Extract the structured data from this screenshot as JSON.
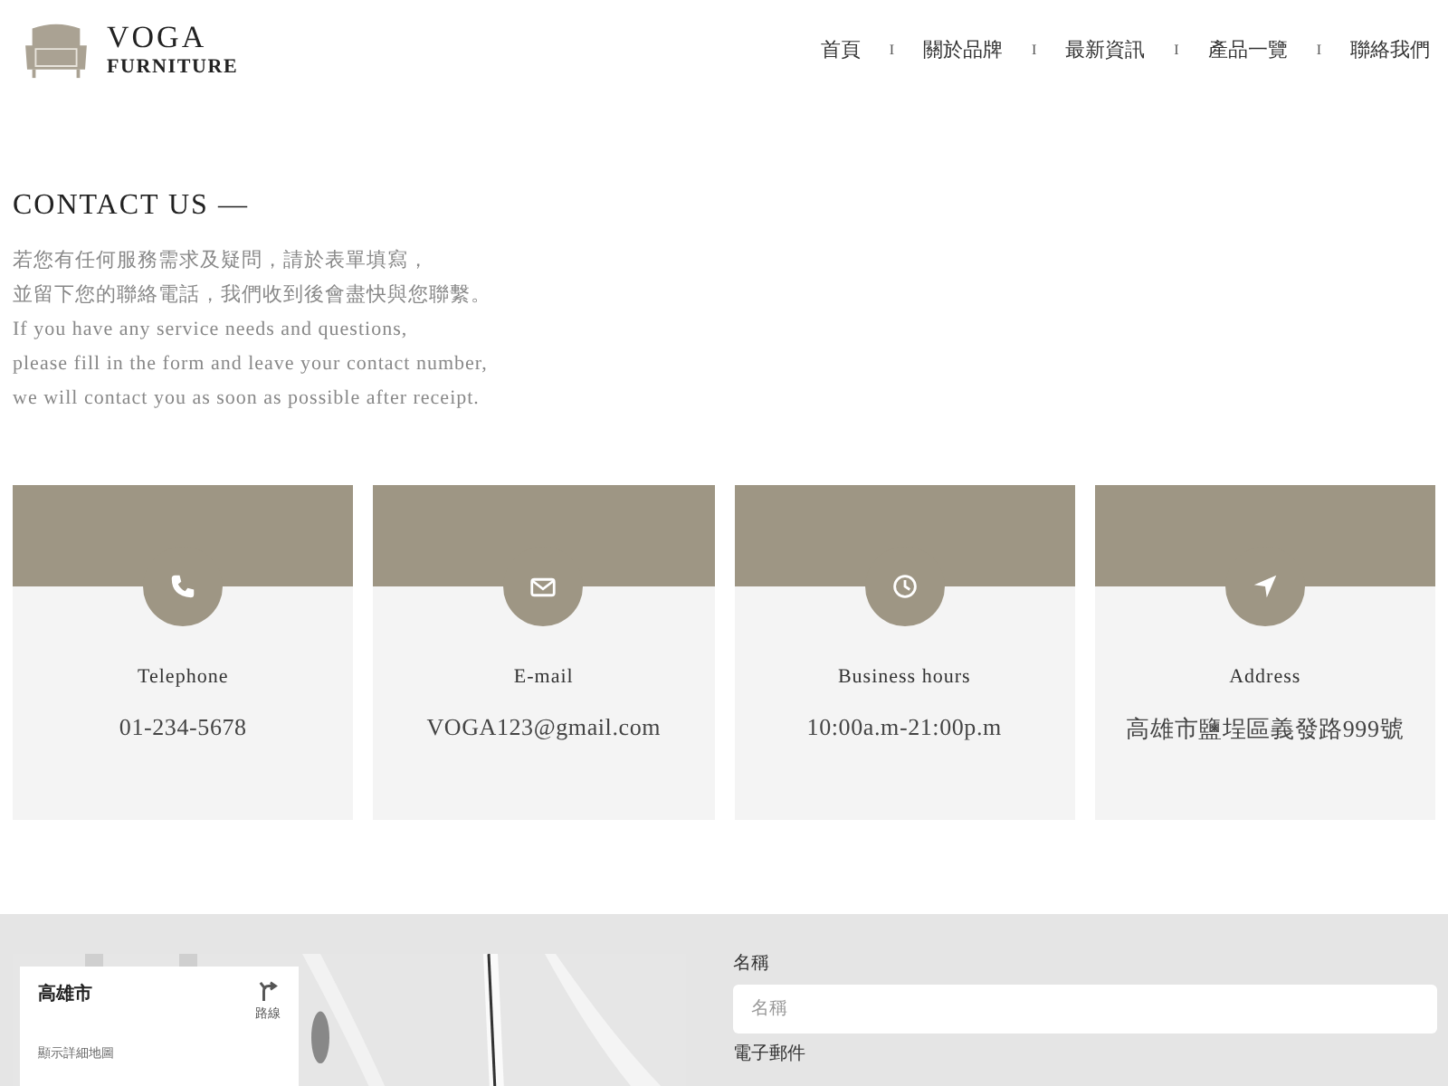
{
  "logo": {
    "name": "VOGA",
    "subtitle": "FURNITURE"
  },
  "nav": [
    {
      "label": "首頁",
      "selected": false
    },
    {
      "label": "關於品牌",
      "selected": false
    },
    {
      "label": "最新資訊",
      "selected": false
    },
    {
      "label": "產品一覽",
      "selected": false
    },
    {
      "label": "聯絡我們",
      "selected": false
    }
  ],
  "nav_separators": [
    "I",
    "I",
    "I",
    "I"
  ],
  "contact": {
    "title": "CONTACT US —",
    "paragraph": [
      "若您有任何服務需求及疑問，請於表單填寫，",
      "並留下您的聯絡電話，我們收到後會盡快與您聯繫。",
      "If you have any service needs and questions,",
      "please fill in the form and leave your contact number,",
      "we will contact you as soon as possible after receipt."
    ]
  },
  "cards": [
    {
      "kind": "phone",
      "title": "Telephone",
      "value": "01-234-5678"
    },
    {
      "kind": "mail",
      "title": "E-mail",
      "value": "VOGA123@gmail.com"
    },
    {
      "kind": "clock",
      "title": "Business hours",
      "value": "10:00a.m-21:00p.m"
    },
    {
      "kind": "location",
      "title": "Address",
      "value": "高雄市鹽埕區義發路999號"
    }
  ],
  "map": {
    "kind": "picture",
    "place": "高雄市",
    "directions": "路線",
    "larger_map": "顯示詳細地圖"
  },
  "form": {
    "fields": [
      {
        "label": "名稱",
        "placeholder": "名稱"
      },
      {
        "label": "電子郵件"
      }
    ]
  }
}
